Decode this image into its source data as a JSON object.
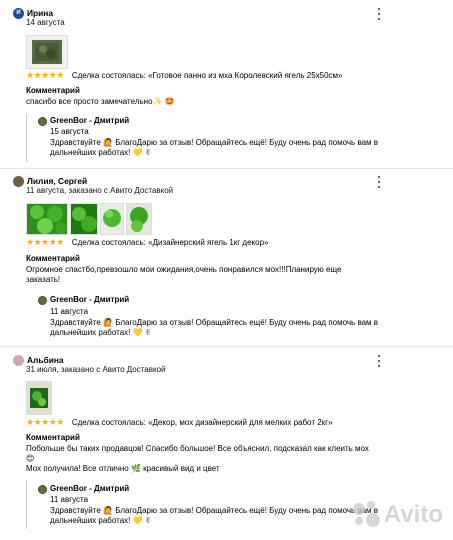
{
  "reviews": [
    {
      "avatar_letter": "И",
      "avatar_color": "#1e4ba0",
      "author": "Ирина",
      "meta": "14 августа",
      "photos": 1,
      "stars": "★★★★★",
      "deal": "Сделка состоялась: «Готовое панно из мха Королевский ягель 25х50см»",
      "comment_label": "Комментарий",
      "comment": "спасибо все просто замечательно✨ 🤩",
      "reply": {
        "author": "GreenBor - Дмитрий",
        "date": "15 августа",
        "text_line1": "Здравствуйте 🙋 БлагоДарю за отзыв! Обращайтесь ещё! Буду очень рад помочь вам в",
        "text_line2": "дальнейших работах! 💛 ✌"
      }
    },
    {
      "avatar_letter": "",
      "avatar_color": "#6b5e4a",
      "author": "Лилия, Сергей",
      "meta": "11 августа, заказано с Авито Доставкой",
      "photos": 4,
      "stars": "★★★★★",
      "deal": "Сделка состоялась: «Дизайнерский ягель 1кг декор»",
      "comment_label": "Комментарий",
      "comment_line1": "Огромное спастбо,превзошло мои ожидания,очень понравился мох!!!Планирую еще",
      "comment_line2": "заказать!",
      "reply": {
        "author": "GreenBor - Дмитрий",
        "date": "11 августа",
        "text_line1": "Здравствуйте 🙋 БлагоДарю за отзыв! Обращайтесь ещё! Буду очень рад помочь вам в",
        "text_line2": "дальнейших работах! 💛 ✌"
      }
    },
    {
      "avatar_letter": "",
      "avatar_color": "#c9a9a9",
      "author": "Альбина",
      "meta": "31 июля, заказано с Авито Доставкой",
      "photos": 1,
      "stars": "★★★★★",
      "deal": "Сделка состоялась: «Декор, мох дизайнерский для мелких работ 2кг»",
      "comment_label": "Комментарий",
      "comment_line1": "Побольше бы таких продавцов! Спасибо большое! Все объяснил, подсказал как клеить мох",
      "comment_line2": "😊",
      "comment_line3": "Мох получила! Все отлично 🌿 красивый вид и цвет",
      "reply": {
        "author": "GreenBor - Дмитрий",
        "date": "11 августа",
        "text_line1": "Здравствуйте 🙋 БлагоДарю за отзыв! Обращайтесь ещё! Буду очень рад помочь вам в",
        "text_line2": "дальнейших работах! 💛 ✌"
      }
    }
  ],
  "watermark": "Avito",
  "colors": {
    "star": "#f6b400",
    "reply_bar": "#c9c9c9"
  }
}
